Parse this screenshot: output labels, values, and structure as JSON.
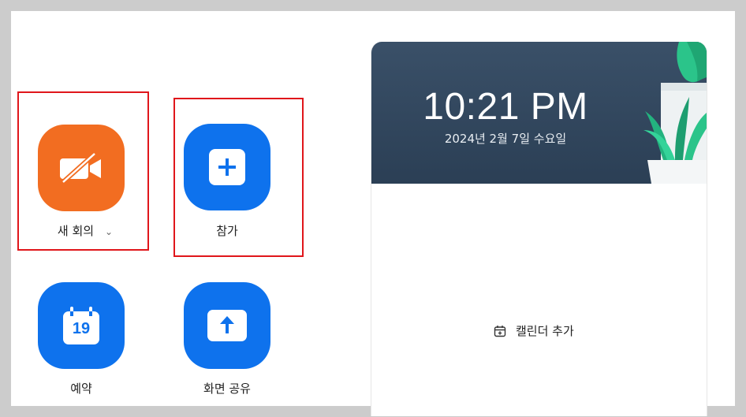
{
  "actions": {
    "new_meeting": {
      "label": "새 회의",
      "icon": "video-off-icon",
      "color": "#f26d21"
    },
    "join": {
      "label": "참가",
      "icon": "plus-icon",
      "color": "#0e72ed"
    },
    "schedule": {
      "label": "예약",
      "icon": "calendar-icon",
      "calendar_day": "19",
      "color": "#0e72ed"
    },
    "share_screen": {
      "label": "화면 공유",
      "icon": "upload-arrow-icon",
      "color": "#0e72ed"
    }
  },
  "clock_card": {
    "time": "10:21 PM",
    "date": "2024년 2월 7일 수요일",
    "add_calendar_label": "캘린더 추가"
  },
  "highlight_color": "#e0161b"
}
